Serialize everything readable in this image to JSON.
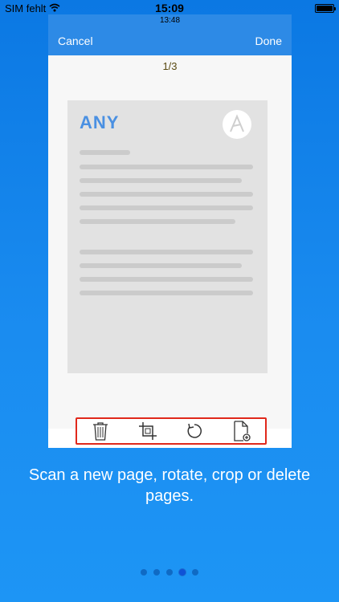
{
  "status_bar": {
    "carrier": "SIM fehlt",
    "time": "15:09"
  },
  "inner_status": {
    "time": "13:48"
  },
  "navbar": {
    "cancel_label": "Cancel",
    "done_label": "Done"
  },
  "page_counter": "1/3",
  "document": {
    "logo_text": "ANY"
  },
  "toolbar": {
    "icons": [
      "trash-icon",
      "crop-icon",
      "rotate-icon",
      "add-page-icon"
    ]
  },
  "caption": "Scan a new page, rotate, crop or delete pages.",
  "pager": {
    "total": 5,
    "active_index": 3
  },
  "colors": {
    "accent": "#2d8ae6",
    "highlight": "#e0281b",
    "logo": "#4a90e2"
  }
}
